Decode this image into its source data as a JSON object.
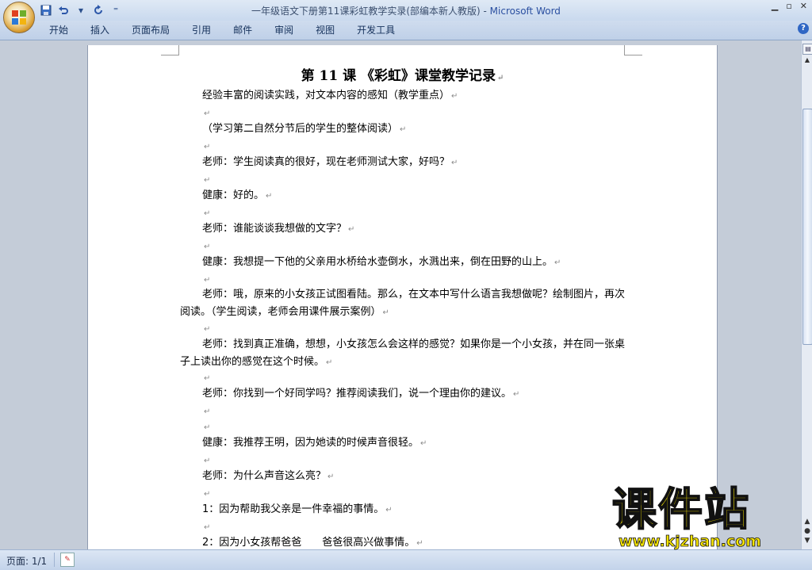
{
  "window": {
    "doc_title": "一年级语文下册第11课彩虹教学实录(部编本新人教版)",
    "app_name": "Microsoft Word",
    "separator": " - "
  },
  "quick_access": [
    "save-icon",
    "undo-icon",
    "redo-icon",
    "customize-icon"
  ],
  "ribbon_tabs": [
    "开始",
    "插入",
    "页面布局",
    "引用",
    "邮件",
    "审阅",
    "视图",
    "开发工具"
  ],
  "document": {
    "heading": "第 11 课 《彩虹》课堂教学记录",
    "paragraphs": [
      "经验丰富的阅读实践，对文本内容的感知（教学重点）",
      "",
      "（学习第二自然分节后的学生的整体阅读）",
      "",
      "老师：学生阅读真的很好，现在老师测试大家，好吗？",
      "",
      "健康：好的。",
      "",
      "老师：谁能谈谈我想做的文字？",
      "",
      "健康：我想提一下他的父亲用水桥给水壶倒水，水溅出来，倒在田野的山上。",
      "",
      "老师：哦，原来的小女孩正试图看陆。那么，在文本中写什么语言我想做呢？绘制图片，再次阅读。（学生阅读，老师会用课件展示案例）",
      "",
      "老师：找到真正准确，想想，小女孩怎么会这样的感觉？如果你是一个小女孩，并在同一张桌子上读出你的感觉在这个时候。",
      "",
      "老师：你找到一个好同学吗？推荐阅读我们，说一个理由你的建议。",
      "",
      "",
      "健康：我推荐王明，因为她读的时候声音很轻。",
      "",
      "老师：为什么声音这么亮？",
      "",
      "1：因为帮助我父亲是一件幸福的事情。",
      "",
      "2：因为小女孩帮爸爸　　爸爸很高兴做事情。"
    ]
  },
  "status": {
    "page_count": "页面: 1/1"
  },
  "watermark": {
    "main": "课件站",
    "url": "www.kjzhan.com"
  }
}
